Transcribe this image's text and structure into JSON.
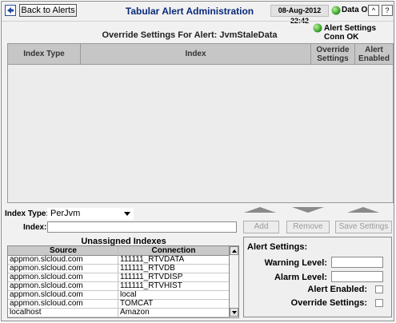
{
  "header": {
    "back_label": "Back to Alerts",
    "title": "Tabular Alert Administration",
    "date": "08-Aug-2012 22:42",
    "data_status": "Data OK",
    "data_status_color": "#2ea01e",
    "caret_up": "^",
    "help": "?"
  },
  "conn_status": "Alert Settings Conn OK",
  "override": {
    "title": "Override Settings For Alert: JvmStaleData",
    "columns": [
      "Index Type",
      "Index",
      "Override Settings",
      "Alert Enabled"
    ]
  },
  "form": {
    "index_type_label": "Index Type:",
    "index_type_value": "PerJvm",
    "index_label": "Index:",
    "index_value": "",
    "add_label": "Add",
    "remove_label": "Remove",
    "save_label": "Save Settings"
  },
  "unassigned": {
    "title": "Unassigned Indexes",
    "columns": [
      "Source",
      "Connection"
    ],
    "rows": [
      {
        "source": "appmon.slcloud.com",
        "connection": "111111_RTVDATA"
      },
      {
        "source": "appmon.slcloud.com",
        "connection": "111111_RTVDB"
      },
      {
        "source": "appmon.slcloud.com",
        "connection": "111111_RTVDISP"
      },
      {
        "source": "appmon.slcloud.com",
        "connection": "111111_RTVHIST"
      },
      {
        "source": "appmon.slcloud.com",
        "connection": "local"
      },
      {
        "source": "appmon.slcloud.com",
        "connection": "TOMCAT"
      },
      {
        "source": "localhost",
        "connection": "Amazon"
      }
    ]
  },
  "settings": {
    "title": "Alert Settings:",
    "warning_label": "Warning Level:",
    "warning_value": "",
    "alarm_label": "Alarm Level:",
    "alarm_value": "",
    "enabled_label": "Alert Enabled:",
    "override_label": "Override Settings:"
  }
}
